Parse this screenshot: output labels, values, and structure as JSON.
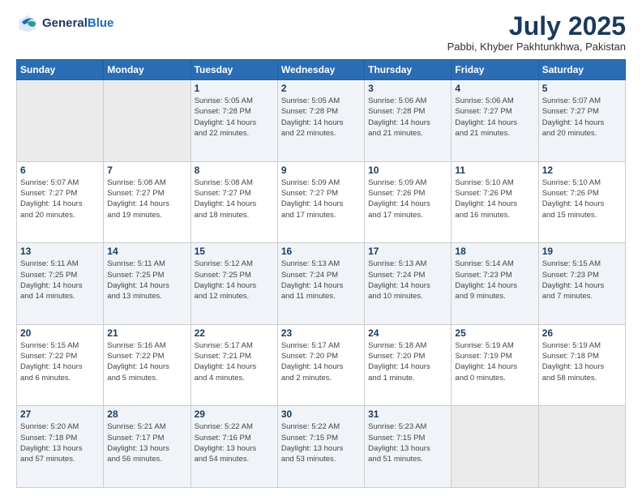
{
  "header": {
    "logo_line1": "General",
    "logo_line2": "Blue",
    "month": "July 2025",
    "location": "Pabbi, Khyber Pakhtunkhwa, Pakistan"
  },
  "weekdays": [
    "Sunday",
    "Monday",
    "Tuesday",
    "Wednesday",
    "Thursday",
    "Friday",
    "Saturday"
  ],
  "weeks": [
    [
      {
        "day": "",
        "info": ""
      },
      {
        "day": "",
        "info": ""
      },
      {
        "day": "1",
        "info": "Sunrise: 5:05 AM\nSunset: 7:28 PM\nDaylight: 14 hours\nand 22 minutes."
      },
      {
        "day": "2",
        "info": "Sunrise: 5:05 AM\nSunset: 7:28 PM\nDaylight: 14 hours\nand 22 minutes."
      },
      {
        "day": "3",
        "info": "Sunrise: 5:06 AM\nSunset: 7:28 PM\nDaylight: 14 hours\nand 21 minutes."
      },
      {
        "day": "4",
        "info": "Sunrise: 5:06 AM\nSunset: 7:27 PM\nDaylight: 14 hours\nand 21 minutes."
      },
      {
        "day": "5",
        "info": "Sunrise: 5:07 AM\nSunset: 7:27 PM\nDaylight: 14 hours\nand 20 minutes."
      }
    ],
    [
      {
        "day": "6",
        "info": "Sunrise: 5:07 AM\nSunset: 7:27 PM\nDaylight: 14 hours\nand 20 minutes."
      },
      {
        "day": "7",
        "info": "Sunrise: 5:08 AM\nSunset: 7:27 PM\nDaylight: 14 hours\nand 19 minutes."
      },
      {
        "day": "8",
        "info": "Sunrise: 5:08 AM\nSunset: 7:27 PM\nDaylight: 14 hours\nand 18 minutes."
      },
      {
        "day": "9",
        "info": "Sunrise: 5:09 AM\nSunset: 7:27 PM\nDaylight: 14 hours\nand 17 minutes."
      },
      {
        "day": "10",
        "info": "Sunrise: 5:09 AM\nSunset: 7:26 PM\nDaylight: 14 hours\nand 17 minutes."
      },
      {
        "day": "11",
        "info": "Sunrise: 5:10 AM\nSunset: 7:26 PM\nDaylight: 14 hours\nand 16 minutes."
      },
      {
        "day": "12",
        "info": "Sunrise: 5:10 AM\nSunset: 7:26 PM\nDaylight: 14 hours\nand 15 minutes."
      }
    ],
    [
      {
        "day": "13",
        "info": "Sunrise: 5:11 AM\nSunset: 7:25 PM\nDaylight: 14 hours\nand 14 minutes."
      },
      {
        "day": "14",
        "info": "Sunrise: 5:11 AM\nSunset: 7:25 PM\nDaylight: 14 hours\nand 13 minutes."
      },
      {
        "day": "15",
        "info": "Sunrise: 5:12 AM\nSunset: 7:25 PM\nDaylight: 14 hours\nand 12 minutes."
      },
      {
        "day": "16",
        "info": "Sunrise: 5:13 AM\nSunset: 7:24 PM\nDaylight: 14 hours\nand 11 minutes."
      },
      {
        "day": "17",
        "info": "Sunrise: 5:13 AM\nSunset: 7:24 PM\nDaylight: 14 hours\nand 10 minutes."
      },
      {
        "day": "18",
        "info": "Sunrise: 5:14 AM\nSunset: 7:23 PM\nDaylight: 14 hours\nand 9 minutes."
      },
      {
        "day": "19",
        "info": "Sunrise: 5:15 AM\nSunset: 7:23 PM\nDaylight: 14 hours\nand 7 minutes."
      }
    ],
    [
      {
        "day": "20",
        "info": "Sunrise: 5:15 AM\nSunset: 7:22 PM\nDaylight: 14 hours\nand 6 minutes."
      },
      {
        "day": "21",
        "info": "Sunrise: 5:16 AM\nSunset: 7:22 PM\nDaylight: 14 hours\nand 5 minutes."
      },
      {
        "day": "22",
        "info": "Sunrise: 5:17 AM\nSunset: 7:21 PM\nDaylight: 14 hours\nand 4 minutes."
      },
      {
        "day": "23",
        "info": "Sunrise: 5:17 AM\nSunset: 7:20 PM\nDaylight: 14 hours\nand 2 minutes."
      },
      {
        "day": "24",
        "info": "Sunrise: 5:18 AM\nSunset: 7:20 PM\nDaylight: 14 hours\nand 1 minute."
      },
      {
        "day": "25",
        "info": "Sunrise: 5:19 AM\nSunset: 7:19 PM\nDaylight: 14 hours\nand 0 minutes."
      },
      {
        "day": "26",
        "info": "Sunrise: 5:19 AM\nSunset: 7:18 PM\nDaylight: 13 hours\nand 58 minutes."
      }
    ],
    [
      {
        "day": "27",
        "info": "Sunrise: 5:20 AM\nSunset: 7:18 PM\nDaylight: 13 hours\nand 57 minutes."
      },
      {
        "day": "28",
        "info": "Sunrise: 5:21 AM\nSunset: 7:17 PM\nDaylight: 13 hours\nand 56 minutes."
      },
      {
        "day": "29",
        "info": "Sunrise: 5:22 AM\nSunset: 7:16 PM\nDaylight: 13 hours\nand 54 minutes."
      },
      {
        "day": "30",
        "info": "Sunrise: 5:22 AM\nSunset: 7:15 PM\nDaylight: 13 hours\nand 53 minutes."
      },
      {
        "day": "31",
        "info": "Sunrise: 5:23 AM\nSunset: 7:15 PM\nDaylight: 13 hours\nand 51 minutes."
      },
      {
        "day": "",
        "info": ""
      },
      {
        "day": "",
        "info": ""
      }
    ]
  ]
}
